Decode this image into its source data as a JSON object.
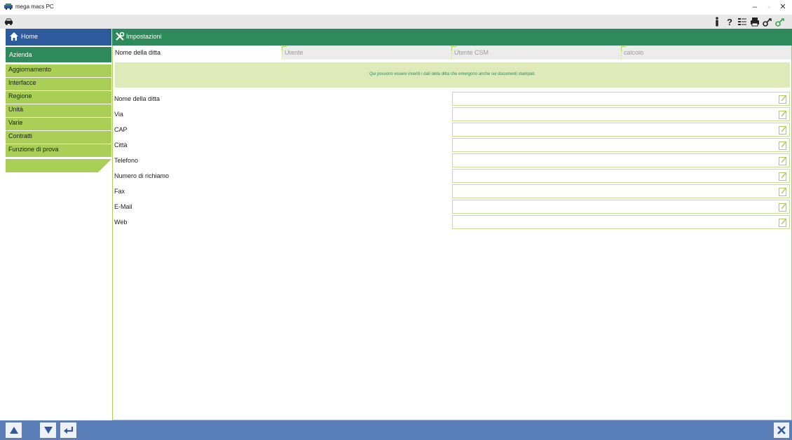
{
  "window": {
    "title": "mega macs PC",
    "minimize": "–",
    "maximize": "▫",
    "close": "✕"
  },
  "toolbar": {
    "icons": [
      "car-icon",
      "person-info-icon",
      "help-icon",
      "list-icon",
      "print-icon",
      "remote-key-icon",
      "remote-key-active-icon"
    ]
  },
  "nav": {
    "home_label": "Home",
    "section_label": "Azienda",
    "items": [
      {
        "label": "Aggiornamento"
      },
      {
        "label": "Interfacce"
      },
      {
        "label": "Regione"
      },
      {
        "label": "Unità"
      },
      {
        "label": "Varie"
      },
      {
        "label": "Contratti"
      },
      {
        "label": "Funzione di prova"
      }
    ]
  },
  "header": {
    "title": "Impostazioni"
  },
  "tabs": [
    {
      "label": "Nome della ditta",
      "active": true
    },
    {
      "label": "Utente",
      "active": false
    },
    {
      "label": "Utente CSM",
      "active": false
    },
    {
      "label": "calcolo",
      "active": false
    }
  ],
  "info": {
    "text": "Qui possono essere inseriti i dati della ditta che emergono anche sui documenti stampati."
  },
  "form": {
    "fields": [
      {
        "label": "Nome della ditta",
        "value": ""
      },
      {
        "label": "Via",
        "value": ""
      },
      {
        "label": "CAP",
        "value": ""
      },
      {
        "label": "Città",
        "value": ""
      },
      {
        "label": "Telefono",
        "value": ""
      },
      {
        "label": "Numero di richiamo",
        "value": ""
      },
      {
        "label": "Fax",
        "value": ""
      },
      {
        "label": "E-Mail",
        "value": ""
      },
      {
        "label": "Web",
        "value": ""
      }
    ]
  },
  "colors": {
    "nav_blue": "#2d5a9c",
    "header_green": "#2e8a5a",
    "nav_item_green": "#a9cf56",
    "info_bg": "#dfeab9",
    "bottom_bar": "#5a7fb8"
  }
}
